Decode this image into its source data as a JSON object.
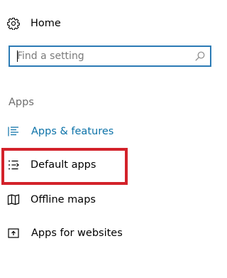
{
  "nav": {
    "home": {
      "label": "Home",
      "icon": "gear-icon"
    },
    "search": {
      "placeholder": "Find a setting",
      "value": "",
      "icon": "search-icon"
    },
    "section_header": "Apps",
    "items": [
      {
        "label": "Apps & features",
        "icon": "list-icon",
        "selected": true
      },
      {
        "label": "Default apps",
        "icon": "default-apps-list-icon",
        "selected": false
      },
      {
        "label": "Offline maps",
        "icon": "map-icon",
        "selected": false
      },
      {
        "label": "Apps for websites",
        "icon": "open-in-window-icon",
        "selected": false
      }
    ]
  },
  "colors": {
    "accent": "#0c72a8",
    "search_border": "#2c7bb5",
    "highlight": "#d3222a",
    "section_header": "#6d6d6d"
  }
}
